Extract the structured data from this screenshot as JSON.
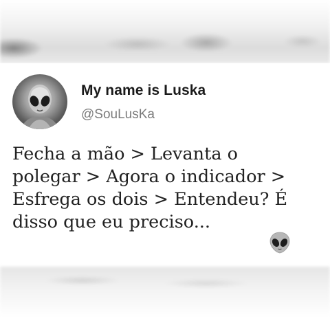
{
  "tweet": {
    "display_name": "My name is Luska",
    "handle": "@SouLusKa",
    "text_lines": [
      "Fecha a mão > Levanta o",
      "polegar > Agora o indicador >",
      "Esfrega os dois > Entendeu? É",
      "disso que eu preciso..."
    ],
    "emoji": "alien-emoji"
  }
}
